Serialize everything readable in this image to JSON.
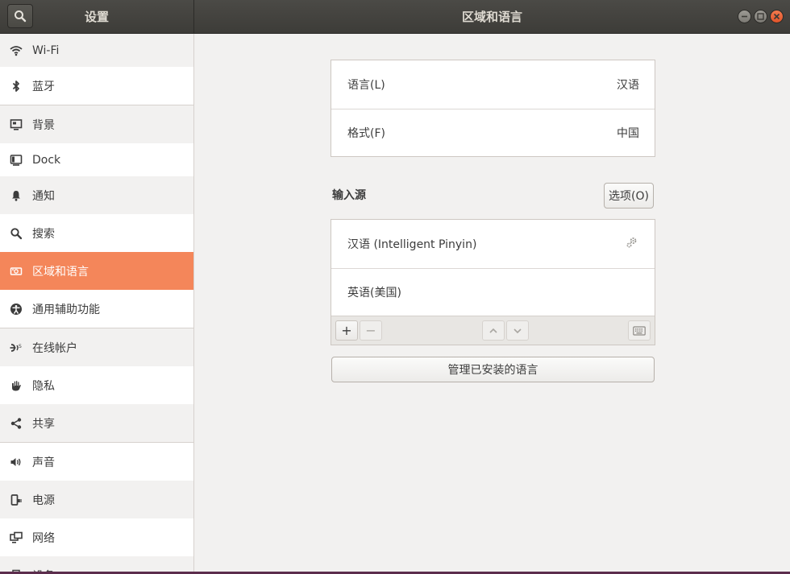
{
  "header": {
    "left_title": "设置",
    "main_title": "区域和语言"
  },
  "sidebar": {
    "items": [
      {
        "label": "Wi-Fi",
        "icon": "wifi-icon"
      },
      {
        "label": "蓝牙",
        "icon": "bluetooth-icon"
      },
      {
        "label": "背景",
        "icon": "background-icon"
      },
      {
        "label": "Dock",
        "icon": "dock-icon"
      },
      {
        "label": "通知",
        "icon": "bell-icon"
      },
      {
        "label": "搜索",
        "icon": "search-icon"
      },
      {
        "label": "区域和语言",
        "icon": "region-language-icon"
      },
      {
        "label": "通用辅助功能",
        "icon": "accessibility-icon"
      },
      {
        "label": "在线帐户",
        "icon": "online-accounts-icon"
      },
      {
        "label": "隐私",
        "icon": "privacy-hand-icon"
      },
      {
        "label": "共享",
        "icon": "share-icon"
      },
      {
        "label": "声音",
        "icon": "speaker-icon"
      },
      {
        "label": "电源",
        "icon": "power-plug-icon"
      },
      {
        "label": "网络",
        "icon": "network-icon"
      },
      {
        "label": "设备",
        "icon": "printer-icon"
      }
    ],
    "active_index": 6,
    "accent_color": "#f4865a"
  },
  "language_panel": {
    "language_label": "语言(L)",
    "language_value": "汉语",
    "format_label": "格式(F)",
    "format_value": "中国"
  },
  "input_sources": {
    "title": "输入源",
    "options_button": "选项(O)",
    "sources": [
      {
        "label": "汉语 (Intelligent Pinyin)",
        "has_settings": true
      },
      {
        "label": "英语(美国)",
        "has_settings": false
      }
    ],
    "toolbar": {
      "add": "+",
      "remove": "−"
    }
  },
  "manage_languages_button": "管理已安装的语言"
}
